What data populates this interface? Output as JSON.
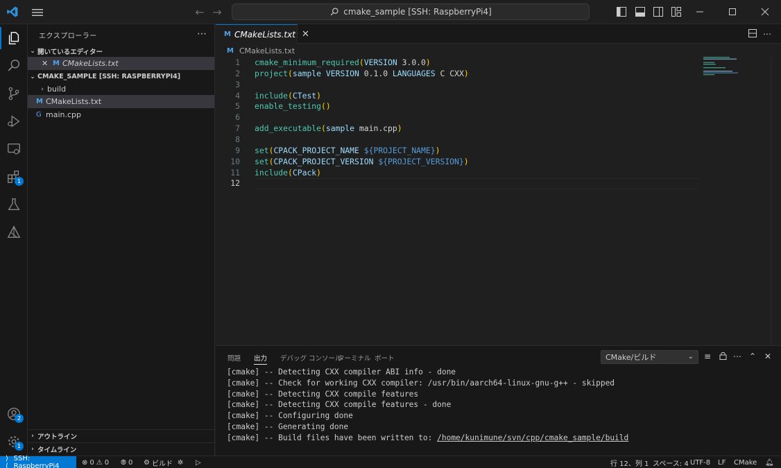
{
  "titlebar": {
    "search_text": "cmake_sample [SSH: RaspberryPi4]"
  },
  "activity": {
    "extensions_badge": "1",
    "accounts_badge": "2",
    "settings_badge": "1"
  },
  "sidebar": {
    "title": "エクスプローラー",
    "open_editors_label": "開いているエディター",
    "open_editor_file": "CMakeLists.txt",
    "folder_label": "CMAKE_SAMPLE [SSH: RASPBERRYPI4]",
    "items": [
      {
        "label": "build",
        "icon": "chevron-right-icon"
      },
      {
        "label": "CMakeLists.txt",
        "icon": "m-icon"
      },
      {
        "label": "main.cpp",
        "icon": "cpp-icon"
      }
    ],
    "outline_label": "アウトライン",
    "timeline_label": "タイムライン"
  },
  "editor": {
    "tab_label": "CMakeLists.txt",
    "breadcrumb": "CMakeLists.txt",
    "line_numbers": [
      "1",
      "2",
      "3",
      "4",
      "5",
      "6",
      "7",
      "8",
      "9",
      "10",
      "11",
      "12"
    ],
    "lines": [
      [
        [
          "fn",
          "cmake_minimum_required"
        ],
        [
          "pr",
          "("
        ],
        [
          "id",
          "VERSION"
        ],
        [
          "tx",
          " 3.0.0"
        ],
        [
          "pr",
          ")"
        ]
      ],
      [
        [
          "fn",
          "project"
        ],
        [
          "pr",
          "("
        ],
        [
          "id",
          "sample"
        ],
        [
          "tx",
          " "
        ],
        [
          "id",
          "VERSION"
        ],
        [
          "tx",
          " 0.1.0 "
        ],
        [
          "id",
          "LANGUAGES"
        ],
        [
          "tx",
          " C CXX"
        ],
        [
          "pr",
          ")"
        ]
      ],
      [],
      [
        [
          "fn",
          "include"
        ],
        [
          "pr",
          "("
        ],
        [
          "id",
          "CTest"
        ],
        [
          "pr",
          ")"
        ]
      ],
      [
        [
          "fn",
          "enable_testing"
        ],
        [
          "pr",
          "()"
        ]
      ],
      [],
      [
        [
          "fn",
          "add_executable"
        ],
        [
          "pr",
          "("
        ],
        [
          "id",
          "sample"
        ],
        [
          "tx",
          " main.cpp"
        ],
        [
          "pr",
          ")"
        ]
      ],
      [],
      [
        [
          "fn",
          "set"
        ],
        [
          "pr",
          "("
        ],
        [
          "id",
          "CPACK_PROJECT_NAME"
        ],
        [
          "tx",
          " "
        ],
        [
          "vr",
          "${PROJECT_NAME}"
        ],
        [
          "pr",
          ")"
        ]
      ],
      [
        [
          "fn",
          "set"
        ],
        [
          "pr",
          "("
        ],
        [
          "id",
          "CPACK_PROJECT_VERSION"
        ],
        [
          "tx",
          " "
        ],
        [
          "vr",
          "${PROJECT_VERSION}"
        ],
        [
          "pr",
          ")"
        ]
      ],
      [
        [
          "fn",
          "include"
        ],
        [
          "pr",
          "("
        ],
        [
          "id",
          "CPack"
        ],
        [
          "pr",
          ")"
        ]
      ],
      []
    ]
  },
  "panel": {
    "tabs": [
      "問題",
      "出力",
      "デバッグ コンソール",
      "ターミナル",
      "ポート"
    ],
    "active_tab": "出力",
    "channel": "CMake/ビルド",
    "output_lines": [
      "[cmake] -- Detecting CXX compiler ABI info - done",
      "[cmake] -- Check for working CXX compiler: /usr/bin/aarch64-linux-gnu-g++ - skipped",
      "[cmake] -- Detecting CXX compile features",
      "[cmake] -- Detecting CXX compile features - done",
      "[cmake] -- Configuring done",
      "[cmake] -- Generating done",
      "[cmake] -- Build files have been written to: "
    ],
    "output_link": "/home/kunimune/svn/cpp/cmake_sample/build"
  },
  "statusbar": {
    "remote": "SSH: RaspberryPi4",
    "errors": "0",
    "warnings": "0",
    "ports": "0",
    "build": "ビルド",
    "position": "行 12、列 1",
    "spaces": "スペース: 4",
    "encoding": "UTF-8",
    "eol": "LF",
    "language": "CMake"
  },
  "colors": {
    "accent": "#0078d4",
    "background": "#1f1f1f",
    "sidebar": "#181818"
  }
}
